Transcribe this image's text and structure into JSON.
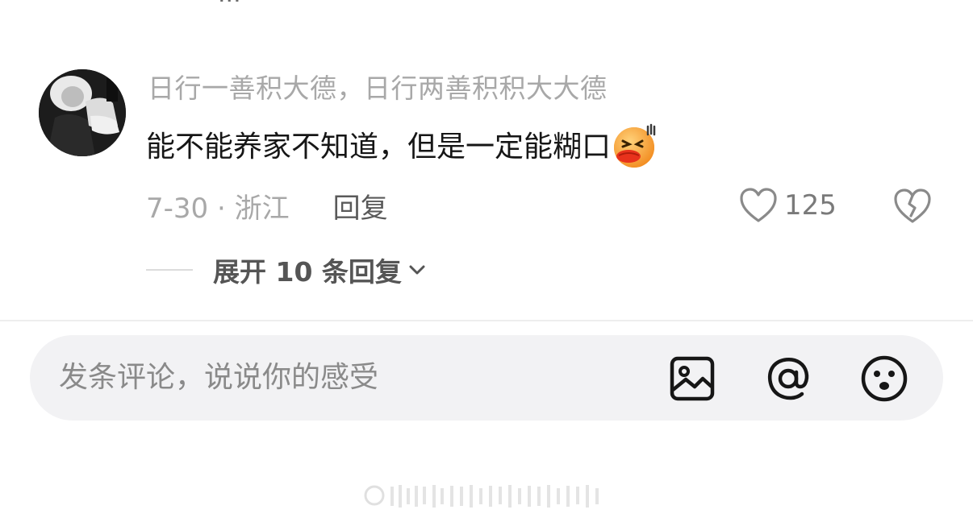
{
  "comment": {
    "username": "日行一善积大德，日行两善积积大大德",
    "text": "能不能养家不知道，但是一定能糊口",
    "emoji_icon": "laughing-face-emoji-icon",
    "date_location": "7-30 · 浙江",
    "reply_label": "回复",
    "like_count": "125",
    "expand_label": "展开 10 条回复"
  },
  "input_bar": {
    "placeholder": "发条评论，说说你的感受",
    "icons": [
      "image-icon",
      "at-icon",
      "emoji-icon"
    ]
  },
  "colors": {
    "background": "#ffffff",
    "username": "#a8a8a8",
    "text": "#161616",
    "input_bg": "#f2f2f4",
    "emoji_orange": "#f59a1f",
    "emoji_lips": "#e8321c"
  }
}
